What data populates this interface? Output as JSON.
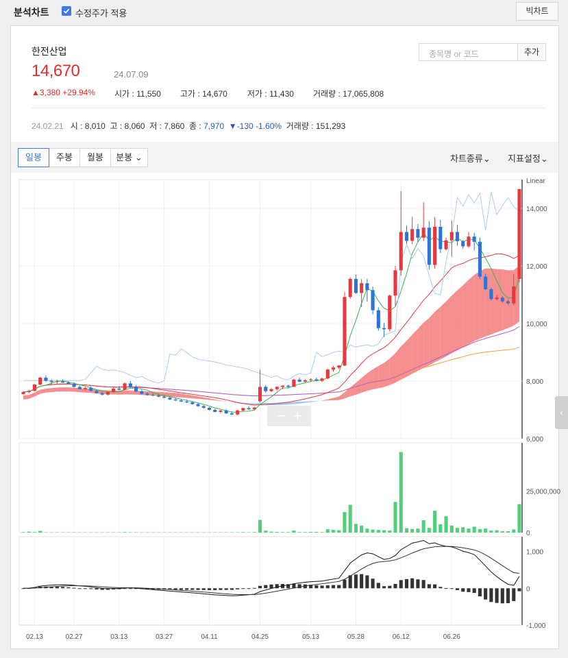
{
  "header": {
    "title": "분석차트",
    "adjusted_price_label": "수정주가 적용",
    "adjusted_price_checked": true,
    "big_chart_button": "빅차트"
  },
  "stock": {
    "name": "한전산업",
    "price": "14,670",
    "date": "24.07.09",
    "change": "3,380",
    "change_pct": "+29.94%",
    "open_label": "시가",
    "open": "11,550",
    "high_label": "고가",
    "high": "14,670",
    "low_label": "저가",
    "low": "11,430",
    "volume_label": "거래량",
    "volume": "17,065,808"
  },
  "search": {
    "placeholder": "종목명 or 코드",
    "add_button": "추가"
  },
  "history": {
    "date": "24.02.21",
    "open_label": "시 :",
    "open": "8,010",
    "high_label": "고 :",
    "high": "8,060",
    "low_label": "저 :",
    "low": "7,860",
    "close_label": "종 :",
    "close": "7,970",
    "change": "-130",
    "change_pct": "-1.60%",
    "volume_label": "거래량 :",
    "volume": "151,293"
  },
  "period_tabs": [
    "일봉",
    "주봉",
    "월봉",
    "분봉"
  ],
  "menus": {
    "chart_type": "차트종류",
    "indicator": "지표설정"
  },
  "colors": {
    "up": "#e8373d",
    "down": "#2f73d4",
    "volume": "#51cf7a",
    "cloud_up": "#f26a6a",
    "cloud_down": "#7fb1ee"
  },
  "chart_data": {
    "type": "candlestick",
    "price_axis": {
      "scale_label": "Linear",
      "ticks": [
        "14,000",
        "12,000",
        "10,000",
        "8,000",
        "6,000"
      ],
      "ylim": [
        6000,
        15000
      ]
    },
    "volume_axis": {
      "ticks": [
        "25,000,000",
        "0"
      ]
    },
    "macd_axis": {
      "ticks": [
        "1,000",
        "0",
        "-1,000"
      ]
    },
    "x_ticks": [
      "02.13",
      "02.27",
      "03.13",
      "03.27",
      "04.11",
      "04.25",
      "05.13",
      "05.28",
      "06.12",
      "06.26"
    ],
    "candles": [
      [
        7550,
        7650,
        7530,
        7620
      ],
      [
        7620,
        7700,
        7580,
        7660
      ],
      [
        7660,
        7900,
        7640,
        7880
      ],
      [
        7880,
        8150,
        7860,
        8120
      ],
      [
        8120,
        8200,
        7980,
        8010
      ],
      [
        8010,
        8060,
        7860,
        7970
      ],
      [
        7970,
        8050,
        7900,
        7990
      ],
      [
        7990,
        8060,
        7930,
        7950
      ],
      [
        7950,
        8000,
        7880,
        7900
      ],
      [
        7900,
        7960,
        7780,
        7800
      ],
      [
        7800,
        7850,
        7700,
        7720
      ],
      [
        7720,
        7800,
        7680,
        7760
      ],
      [
        7760,
        7820,
        7640,
        7660
      ],
      [
        7660,
        7700,
        7560,
        7580
      ],
      [
        7580,
        7640,
        7500,
        7530
      ],
      [
        7530,
        7640,
        7500,
        7620
      ],
      [
        7620,
        7780,
        7600,
        7740
      ],
      [
        7740,
        7830,
        7680,
        7700
      ],
      [
        7700,
        7950,
        7680,
        7920
      ],
      [
        7920,
        8000,
        7760,
        7790
      ],
      [
        7790,
        7850,
        7620,
        7640
      ],
      [
        7640,
        7700,
        7540,
        7560
      ],
      [
        7560,
        7620,
        7490,
        7520
      ],
      [
        7520,
        7580,
        7470,
        7500
      ],
      [
        7500,
        7560,
        7440,
        7460
      ],
      [
        7460,
        7520,
        7400,
        7420
      ],
      [
        7420,
        7470,
        7340,
        7360
      ],
      [
        7360,
        7420,
        7300,
        7330
      ],
      [
        7330,
        7380,
        7270,
        7290
      ],
      [
        7290,
        7350,
        7240,
        7260
      ],
      [
        7260,
        7300,
        7180,
        7200
      ],
      [
        7200,
        7240,
        7110,
        7130
      ],
      [
        7130,
        7170,
        7050,
        7070
      ],
      [
        7070,
        7100,
        6980,
        7000
      ],
      [
        7000,
        7040,
        6910,
        6930
      ],
      [
        6930,
        7000,
        6880,
        6980
      ],
      [
        6980,
        7020,
        6860,
        6880
      ],
      [
        6880,
        6950,
        6820,
        6840
      ],
      [
        6840,
        7000,
        6810,
        6980
      ],
      [
        6980,
        7080,
        6950,
        7060
      ],
      [
        7060,
        7130,
        7000,
        7020
      ],
      [
        7020,
        7100,
        7000,
        7080
      ],
      [
        7300,
        8400,
        7250,
        7800
      ],
      [
        7800,
        7860,
        7600,
        7650
      ],
      [
        7650,
        7760,
        7620,
        7720
      ],
      [
        7720,
        7820,
        7660,
        7800
      ],
      [
        7800,
        7860,
        7720,
        7840
      ],
      [
        7840,
        7880,
        7760,
        7800
      ],
      [
        7800,
        8080,
        7790,
        8050
      ],
      [
        8050,
        8120,
        7960,
        7980
      ],
      [
        7980,
        8060,
        7950,
        8030
      ],
      [
        8030,
        8100,
        7980,
        8060
      ],
      [
        8060,
        8120,
        7990,
        8010
      ],
      [
        8010,
        8120,
        7970,
        8090
      ],
      [
        8090,
        8430,
        8070,
        8400
      ],
      [
        8400,
        8520,
        8330,
        8470
      ],
      [
        8470,
        8560,
        8420,
        8540
      ],
      [
        8540,
        11090,
        8520,
        10920
      ],
      [
        10920,
        11600,
        10860,
        11550
      ],
      [
        11550,
        11700,
        11030,
        11060
      ],
      [
        11060,
        11540,
        10570,
        11400
      ],
      [
        11400,
        11550,
        10760,
        11160
      ],
      [
        11160,
        11280,
        10320,
        10460
      ],
      [
        10460,
        10560,
        9750,
        9840
      ],
      [
        9840,
        10020,
        9530,
        9800
      ],
      [
        9800,
        11000,
        9720,
        10970
      ],
      [
        10970,
        12000,
        10600,
        11850
      ],
      [
        11850,
        14600,
        11660,
        13180
      ],
      [
        13180,
        13400,
        12760,
        12870
      ],
      [
        12870,
        13700,
        12760,
        13280
      ],
      [
        13280,
        13450,
        12830,
        12980
      ],
      [
        12980,
        14210,
        12870,
        13330
      ],
      [
        13330,
        13560,
        11870,
        12040
      ],
      [
        12040,
        13690,
        11900,
        13360
      ],
      [
        13360,
        13600,
        12450,
        12580
      ],
      [
        12580,
        12990,
        12540,
        12890
      ],
      [
        12890,
        13580,
        12320,
        13180
      ],
      [
        13180,
        13420,
        12700,
        12860
      ],
      [
        12860,
        12900,
        12600,
        12680
      ],
      [
        12680,
        13180,
        12630,
        13020
      ],
      [
        13020,
        13160,
        12540,
        12840
      ],
      [
        12840,
        12980,
        11550,
        11630
      ],
      [
        11630,
        11730,
        11160,
        11190
      ],
      [
        11190,
        11240,
        10800,
        10850
      ],
      [
        10850,
        11000,
        10800,
        10900
      ],
      [
        10900,
        10950,
        10720,
        10770
      ],
      [
        10770,
        10830,
        10660,
        10700
      ],
      [
        10700,
        11720,
        10630,
        11290
      ],
      [
        11550,
        14670,
        11430,
        14670
      ]
    ],
    "volumes_millions": [
      0.3,
      0.6,
      0.3,
      1.0,
      0.2,
      0.15,
      0.2,
      0.2,
      0.2,
      0.2,
      0.15,
      0.15,
      0.15,
      0.15,
      0.15,
      0.2,
      0.2,
      0.2,
      0.3,
      0.2,
      0.2,
      0.15,
      0.15,
      0.15,
      0.15,
      0.15,
      0.15,
      0.15,
      0.15,
      0.15,
      0.15,
      0.15,
      0.15,
      0.15,
      0.2,
      0.2,
      0.2,
      0.2,
      0.2,
      0.3,
      0.2,
      0.3,
      7.6,
      1.2,
      0.6,
      0.4,
      0.3,
      0.3,
      1.2,
      0.3,
      0.3,
      0.4,
      0.4,
      0.3,
      2.0,
      1.6,
      1.4,
      12.3,
      16.7,
      5.2,
      4.2,
      2.4,
      1.8,
      1.6,
      1.4,
      1.2,
      18.4,
      48.4,
      2.6,
      2.2,
      2.4,
      7.4,
      2.8,
      13.1,
      5.0,
      9.8,
      4.2,
      2.8,
      3.2,
      2.4,
      3.5,
      2.1,
      2.4,
      1.2,
      1.4,
      0.8,
      0.8,
      1.9,
      17.1
    ],
    "macd_range": [
      -1000,
      1400
    ]
  }
}
